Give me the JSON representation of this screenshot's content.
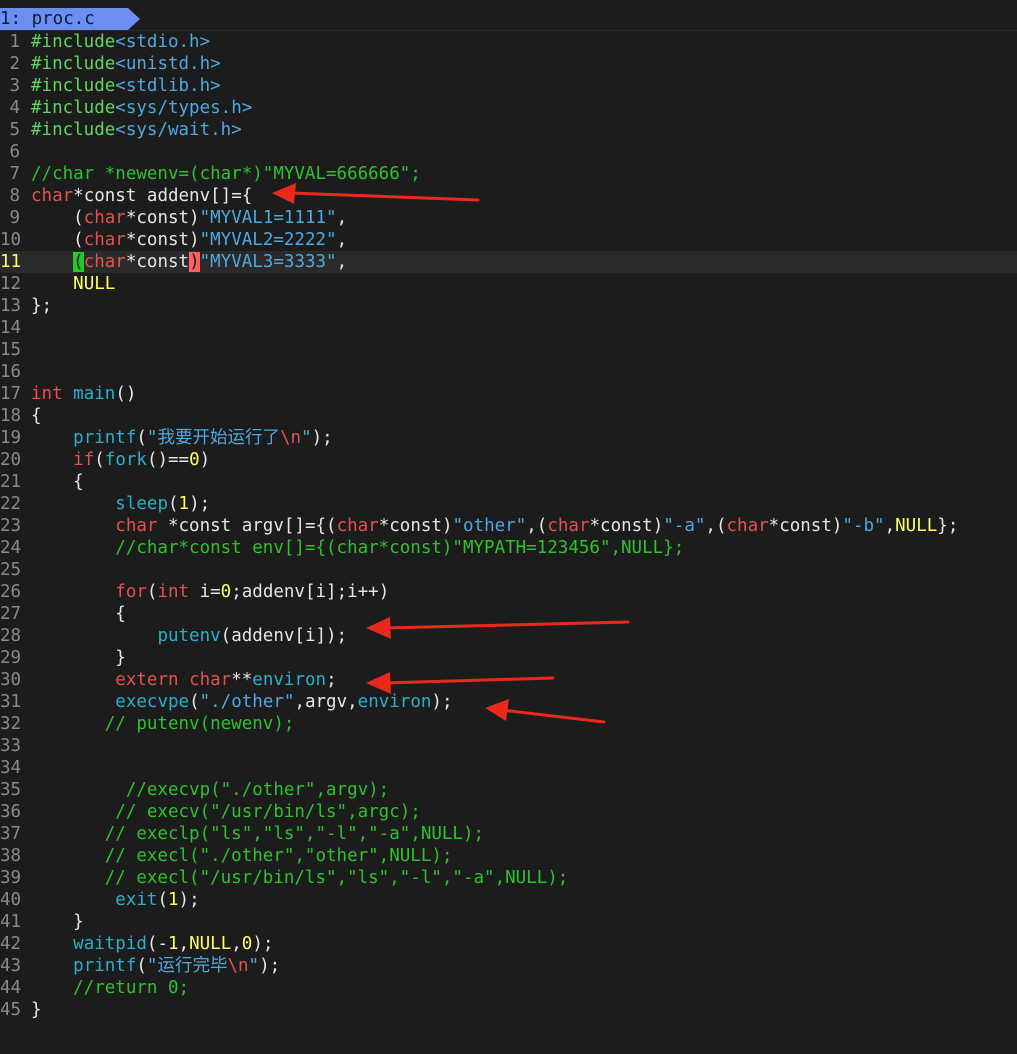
{
  "tab": {
    "label": "1: proc.c"
  },
  "colors": {
    "background": "#1c1c1c",
    "tab": "#6a8ff0",
    "comment": "#2ec22e",
    "keyword": "#e65050",
    "string": "#4fa8e0",
    "function": "#2ab0c8",
    "number": "#ffff60",
    "annotation_arrow": "#e8291c"
  },
  "lines": [
    {
      "n": "1",
      "tokens": [
        {
          "t": "#include",
          "c": "pp"
        },
        {
          "t": "<stdio.h>",
          "c": "inc"
        }
      ]
    },
    {
      "n": "2",
      "tokens": [
        {
          "t": "#include",
          "c": "pp"
        },
        {
          "t": "<unistd.h>",
          "c": "inc"
        }
      ]
    },
    {
      "n": "3",
      "tokens": [
        {
          "t": "#include",
          "c": "pp"
        },
        {
          "t": "<stdlib.h>",
          "c": "inc"
        }
      ]
    },
    {
      "n": "4",
      "tokens": [
        {
          "t": "#include",
          "c": "pp"
        },
        {
          "t": "<sys/types.h>",
          "c": "inc"
        }
      ]
    },
    {
      "n": "5",
      "tokens": [
        {
          "t": "#include",
          "c": "pp"
        },
        {
          "t": "<sys/wait.h>",
          "c": "inc"
        }
      ]
    },
    {
      "n": "6",
      "tokens": []
    },
    {
      "n": "7",
      "tokens": [
        {
          "t": "//char *newenv=(char*)\"MYVAL=666666\";",
          "c": "cmt"
        }
      ]
    },
    {
      "n": "8",
      "tokens": [
        {
          "t": "char",
          "c": "kw"
        },
        {
          "t": "*const addenv[]={",
          "c": "plain"
        }
      ]
    },
    {
      "n": "9",
      "tokens": [
        {
          "t": "    (",
          "c": "plain"
        },
        {
          "t": "char",
          "c": "kw"
        },
        {
          "t": "*const)",
          "c": "plain"
        },
        {
          "t": "\"MYVAL1=1111\"",
          "c": "str"
        },
        {
          "t": ",",
          "c": "plain"
        }
      ]
    },
    {
      "n": "10",
      "tokens": [
        {
          "t": "    (",
          "c": "plain"
        },
        {
          "t": "char",
          "c": "kw"
        },
        {
          "t": "*const)",
          "c": "plain"
        },
        {
          "t": "\"MYVAL2=2222\"",
          "c": "str"
        },
        {
          "t": ",",
          "c": "plain"
        }
      ]
    },
    {
      "n": "11",
      "cur": true,
      "tokens": [
        {
          "t": "    ",
          "c": "plain"
        },
        {
          "t": "(",
          "c": "mb1"
        },
        {
          "t": "char",
          "c": "kw"
        },
        {
          "t": "*const",
          "c": "plain"
        },
        {
          "t": ")",
          "c": "mb2"
        },
        {
          "t": "\"MYVAL3=3333\"",
          "c": "str"
        },
        {
          "t": ",",
          "c": "plain"
        }
      ]
    },
    {
      "n": "12",
      "tokens": [
        {
          "t": "    ",
          "c": "plain"
        },
        {
          "t": "NULL",
          "c": "const"
        }
      ]
    },
    {
      "n": "13",
      "tokens": [
        {
          "t": "};",
          "c": "plain"
        }
      ]
    },
    {
      "n": "14",
      "tokens": []
    },
    {
      "n": "15",
      "tokens": []
    },
    {
      "n": "16",
      "tokens": []
    },
    {
      "n": "17",
      "tokens": [
        {
          "t": "int",
          "c": "kw"
        },
        {
          "t": " ",
          "c": "plain"
        },
        {
          "t": "main",
          "c": "fn"
        },
        {
          "t": "()",
          "c": "plain"
        }
      ]
    },
    {
      "n": "18",
      "tokens": [
        {
          "t": "{",
          "c": "plain"
        }
      ]
    },
    {
      "n": "19",
      "tokens": [
        {
          "t": "    ",
          "c": "plain"
        },
        {
          "t": "printf",
          "c": "fn"
        },
        {
          "t": "(",
          "c": "plain"
        },
        {
          "t": "\"我要开始运行了",
          "c": "str"
        },
        {
          "t": "\\n",
          "c": "esc"
        },
        {
          "t": "\"",
          "c": "str"
        },
        {
          "t": ");",
          "c": "plain"
        }
      ]
    },
    {
      "n": "20",
      "tokens": [
        {
          "t": "    ",
          "c": "plain"
        },
        {
          "t": "if",
          "c": "kw"
        },
        {
          "t": "(",
          "c": "plain"
        },
        {
          "t": "fork",
          "c": "fn"
        },
        {
          "t": "()==",
          "c": "plain"
        },
        {
          "t": "0",
          "c": "num"
        },
        {
          "t": ")",
          "c": "plain"
        }
      ]
    },
    {
      "n": "21",
      "tokens": [
        {
          "t": "    {",
          "c": "plain"
        }
      ]
    },
    {
      "n": "22",
      "tokens": [
        {
          "t": "        ",
          "c": "plain"
        },
        {
          "t": "sleep",
          "c": "fn"
        },
        {
          "t": "(",
          "c": "plain"
        },
        {
          "t": "1",
          "c": "num"
        },
        {
          "t": ");",
          "c": "plain"
        }
      ]
    },
    {
      "n": "23",
      "tokens": [
        {
          "t": "        ",
          "c": "plain"
        },
        {
          "t": "char",
          "c": "kw"
        },
        {
          "t": " *const argv[]={(",
          "c": "plain"
        },
        {
          "t": "char",
          "c": "kw"
        },
        {
          "t": "*const)",
          "c": "plain"
        },
        {
          "t": "\"other\"",
          "c": "str"
        },
        {
          "t": ",(",
          "c": "plain"
        },
        {
          "t": "char",
          "c": "kw"
        },
        {
          "t": "*const)",
          "c": "plain"
        },
        {
          "t": "\"-a\"",
          "c": "str"
        },
        {
          "t": ",(",
          "c": "plain"
        },
        {
          "t": "char",
          "c": "kw"
        },
        {
          "t": "*const)",
          "c": "plain"
        },
        {
          "t": "\"-b\"",
          "c": "str"
        },
        {
          "t": ",",
          "c": "plain"
        },
        {
          "t": "NULL",
          "c": "const"
        },
        {
          "t": "};",
          "c": "plain"
        }
      ]
    },
    {
      "n": "24",
      "tokens": [
        {
          "t": "        //char*const env[]={(char*const)\"MYPATH=123456\",NULL};",
          "c": "cmt"
        }
      ]
    },
    {
      "n": "25",
      "tokens": []
    },
    {
      "n": "26",
      "tokens": [
        {
          "t": "        ",
          "c": "plain"
        },
        {
          "t": "for",
          "c": "kw"
        },
        {
          "t": "(",
          "c": "plain"
        },
        {
          "t": "int",
          "c": "kw"
        },
        {
          "t": " i=",
          "c": "plain"
        },
        {
          "t": "0",
          "c": "num"
        },
        {
          "t": ";addenv[i];i++)",
          "c": "plain"
        }
      ]
    },
    {
      "n": "27",
      "tokens": [
        {
          "t": "        {",
          "c": "plain"
        }
      ]
    },
    {
      "n": "28",
      "tokens": [
        {
          "t": "            ",
          "c": "plain"
        },
        {
          "t": "putenv",
          "c": "fn"
        },
        {
          "t": "(addenv[i]);",
          "c": "plain"
        }
      ]
    },
    {
      "n": "29",
      "tokens": [
        {
          "t": "        }",
          "c": "plain"
        }
      ]
    },
    {
      "n": "30",
      "tokens": [
        {
          "t": "        ",
          "c": "plain"
        },
        {
          "t": "extern",
          "c": "kw"
        },
        {
          "t": " ",
          "c": "plain"
        },
        {
          "t": "char",
          "c": "kw"
        },
        {
          "t": "**",
          "c": "plain"
        },
        {
          "t": "environ",
          "c": "fn"
        },
        {
          "t": ";",
          "c": "plain"
        }
      ]
    },
    {
      "n": "31",
      "tokens": [
        {
          "t": "        ",
          "c": "plain"
        },
        {
          "t": "execvpe",
          "c": "fn"
        },
        {
          "t": "(",
          "c": "plain"
        },
        {
          "t": "\"./other\"",
          "c": "str"
        },
        {
          "t": ",argv,",
          "c": "plain"
        },
        {
          "t": "environ",
          "c": "fn"
        },
        {
          "t": ");",
          "c": "plain"
        }
      ]
    },
    {
      "n": "32",
      "tokens": [
        {
          "t": "       // putenv(newenv);",
          "c": "cmt"
        }
      ]
    },
    {
      "n": "33",
      "tokens": []
    },
    {
      "n": "34",
      "tokens": []
    },
    {
      "n": "35",
      "tokens": [
        {
          "t": "         //execvp(\"./other\",argv);",
          "c": "cmt"
        }
      ]
    },
    {
      "n": "36",
      "tokens": [
        {
          "t": "        // execv(\"/usr/bin/ls\",argc);",
          "c": "cmt"
        }
      ]
    },
    {
      "n": "37",
      "tokens": [
        {
          "t": "       // execlp(\"ls\",\"ls\",\"-l\",\"-a\",NULL);",
          "c": "cmt"
        }
      ]
    },
    {
      "n": "38",
      "tokens": [
        {
          "t": "       // execl(\"./other\",\"other\",NULL);",
          "c": "cmt"
        }
      ]
    },
    {
      "n": "39",
      "tokens": [
        {
          "t": "       // execl(\"/usr/bin/ls\",\"ls\",\"-l\",\"-a\",NULL);",
          "c": "cmt"
        }
      ]
    },
    {
      "n": "40",
      "tokens": [
        {
          "t": "        ",
          "c": "plain"
        },
        {
          "t": "exit",
          "c": "fn"
        },
        {
          "t": "(",
          "c": "plain"
        },
        {
          "t": "1",
          "c": "num"
        },
        {
          "t": ");",
          "c": "plain"
        }
      ]
    },
    {
      "n": "41",
      "tokens": [
        {
          "t": "    }",
          "c": "plain"
        }
      ]
    },
    {
      "n": "42",
      "tokens": [
        {
          "t": "    ",
          "c": "plain"
        },
        {
          "t": "waitpid",
          "c": "fn"
        },
        {
          "t": "(-",
          "c": "plain"
        },
        {
          "t": "1",
          "c": "num"
        },
        {
          "t": ",",
          "c": "plain"
        },
        {
          "t": "NULL",
          "c": "const"
        },
        {
          "t": ",",
          "c": "plain"
        },
        {
          "t": "0",
          "c": "num"
        },
        {
          "t": ");",
          "c": "plain"
        }
      ]
    },
    {
      "n": "43",
      "tokens": [
        {
          "t": "    ",
          "c": "plain"
        },
        {
          "t": "printf",
          "c": "fn"
        },
        {
          "t": "(",
          "c": "plain"
        },
        {
          "t": "\"运行完毕",
          "c": "str"
        },
        {
          "t": "\\n",
          "c": "esc"
        },
        {
          "t": "\"",
          "c": "str"
        },
        {
          "t": ");",
          "c": "plain"
        }
      ]
    },
    {
      "n": "44",
      "tokens": [
        {
          "t": "    //return 0;",
          "c": "cmt"
        }
      ]
    },
    {
      "n": "45",
      "tokens": [
        {
          "t": "}",
          "c": "plain"
        }
      ]
    }
  ],
  "annotations": [
    {
      "name": "arrow-addenv",
      "points_to_line": "8"
    },
    {
      "name": "arrow-putenv",
      "points_to_line": "28"
    },
    {
      "name": "arrow-extern-environ",
      "points_to_line": "30"
    },
    {
      "name": "arrow-execvpe",
      "points_to_line": "31"
    }
  ]
}
